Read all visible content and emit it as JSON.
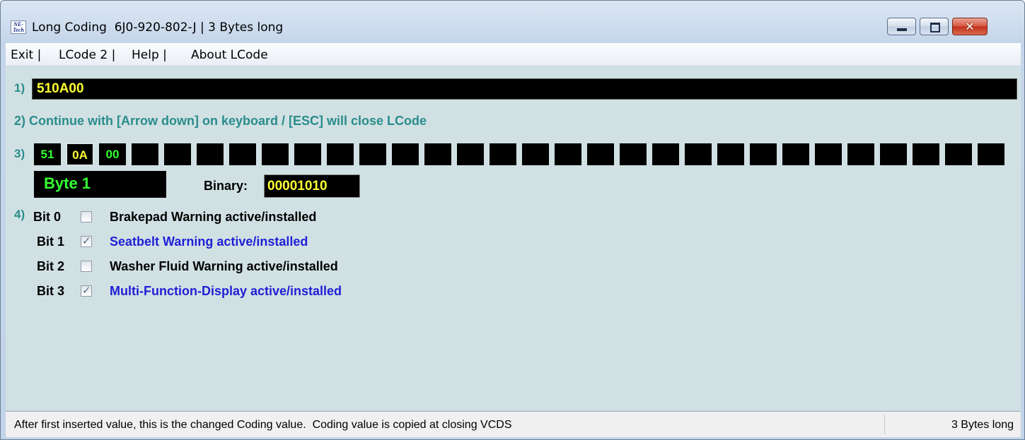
{
  "window": {
    "icon_text": [
      "NE-",
      "Tech"
    ],
    "title": "Long Coding  6J0-920-802-J | 3 Bytes long",
    "controls": {
      "minimize": "minimize",
      "maximize": "maximize",
      "close": "✕"
    }
  },
  "menu": {
    "items": [
      "Exit |",
      "LCode 2 |",
      "Help |",
      "About LCode"
    ]
  },
  "steps": {
    "one_marker": "1)",
    "coding_value": "510A00",
    "two_text": "2) Continue with [Arrow down] on keyboard / [ESC] will close LCode",
    "three_marker": "3)",
    "four_marker": "4)"
  },
  "bytes": {
    "values": [
      "51",
      "0A",
      "00",
      "",
      "",
      "",
      "",
      "",
      "",
      "",
      "",
      "",
      "",
      "",
      "",
      "",
      "",
      "",
      "",
      "",
      "",
      "",
      "",
      "",
      "",
      "",
      "",
      "",
      "",
      ""
    ],
    "selected_index": 1
  },
  "byte_info": {
    "label": "Byte 1",
    "binary_label": "Binary:",
    "binary_value": "00001010"
  },
  "bits": [
    {
      "label": "Bit 0",
      "checked": false,
      "description": "Brakepad Warning active/installed"
    },
    {
      "label": "Bit 1",
      "checked": true,
      "description": "Seatbelt Warning active/installed"
    },
    {
      "label": "Bit 2",
      "checked": false,
      "description": "Washer Fluid Warning active/installed"
    },
    {
      "label": "Bit 3",
      "checked": true,
      "description": "Multi-Function-Display active/installed"
    }
  ],
  "status": {
    "main": "After first inserted value, this is the changed Coding value.  Coding value is copied at closing VCDS",
    "right": "3 Bytes long"
  },
  "colors": {
    "teal": "#2a8c8c",
    "yellow_value": "#ffff33",
    "green_value": "#33ff33",
    "checked_blue": "#1f1fd6",
    "client_bg": "#d1e1e3"
  }
}
